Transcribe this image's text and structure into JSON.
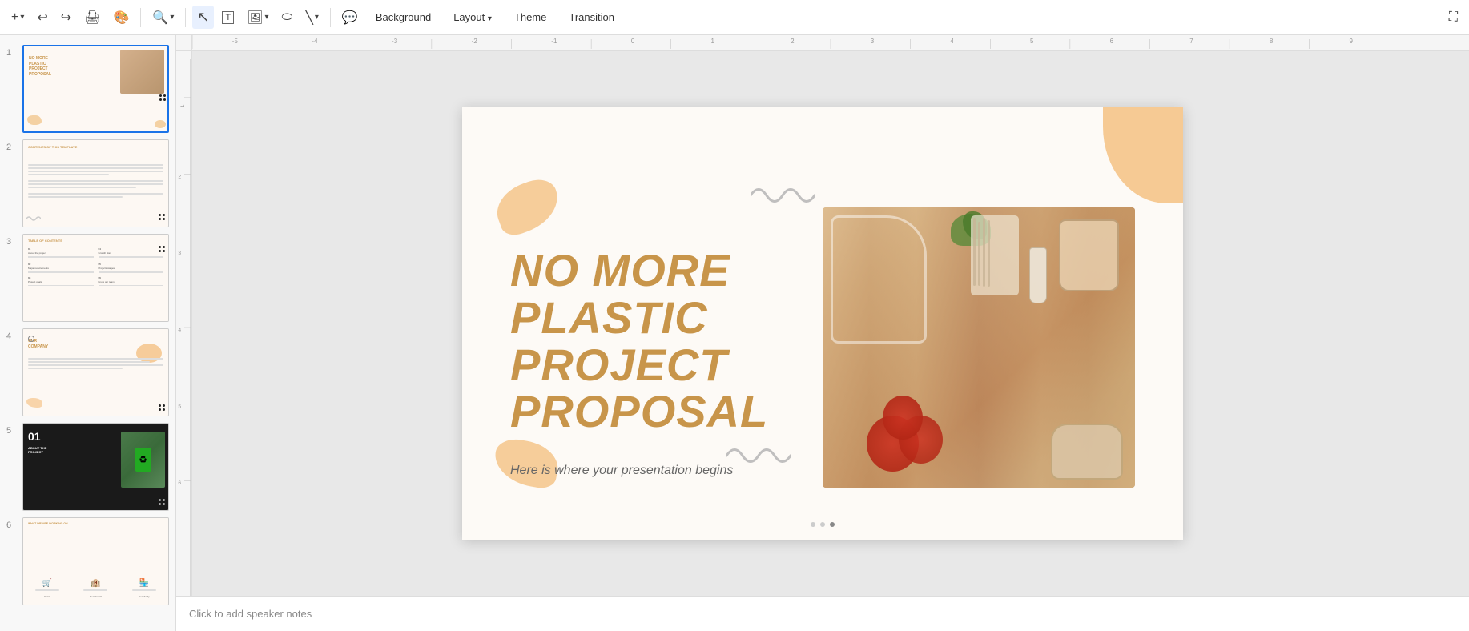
{
  "toolbar": {
    "add_label": "+",
    "undo_label": "↩",
    "redo_label": "↪",
    "print_label": "🖨",
    "paint_label": "🎨",
    "zoom_label": "🔍",
    "cursor_label": "↖",
    "text_label": "T",
    "image_label": "🖼",
    "shape_label": "⬭",
    "line_label": "╲",
    "comment_label": "💬",
    "background_label": "Background",
    "layout_label": "Layout",
    "theme_label": "Theme",
    "transition_label": "Transition",
    "maximize_label": "⛶"
  },
  "slides": [
    {
      "number": "1",
      "active": true,
      "title": "NO MORE PLASTIC PROJECT PROPOSAL"
    },
    {
      "number": "2",
      "active": false,
      "title": "CONTENTS OF THIS TEMPLATE"
    },
    {
      "number": "3",
      "active": false,
      "title": "TABLE OF CONTENTS"
    },
    {
      "number": "4",
      "active": false,
      "title": "OUR COMPANY"
    },
    {
      "number": "5",
      "active": false,
      "title": "01 ABOUT THE PROJECT"
    },
    {
      "number": "6",
      "active": false,
      "title": "WHAT WE ARE WORKING ON"
    }
  ],
  "main_slide": {
    "title_line1": "NO MORE",
    "title_line2": "PLASTIC",
    "title_line3": "PROJECT",
    "title_line4": "PROPOSAL",
    "subtitle": "Here is where your presentation begins"
  },
  "speaker_notes": {
    "placeholder": "Click to add speaker notes"
  },
  "bottom_dots": [
    "inactive",
    "inactive",
    "active"
  ],
  "ruler": {
    "top_marks": [
      "-5",
      "-4",
      "-3",
      "-2",
      "-1",
      "0",
      "1",
      "2",
      "3",
      "4",
      "5",
      "6",
      "7",
      "8",
      "9"
    ],
    "left_marks": [
      "1",
      "2",
      "3",
      "4",
      "5",
      "6"
    ]
  },
  "colors": {
    "peach": "#f5c48a",
    "title_color": "#c8954a",
    "gray_squig": "#b0b0b0",
    "dark_dot": "#2a2a2a"
  }
}
